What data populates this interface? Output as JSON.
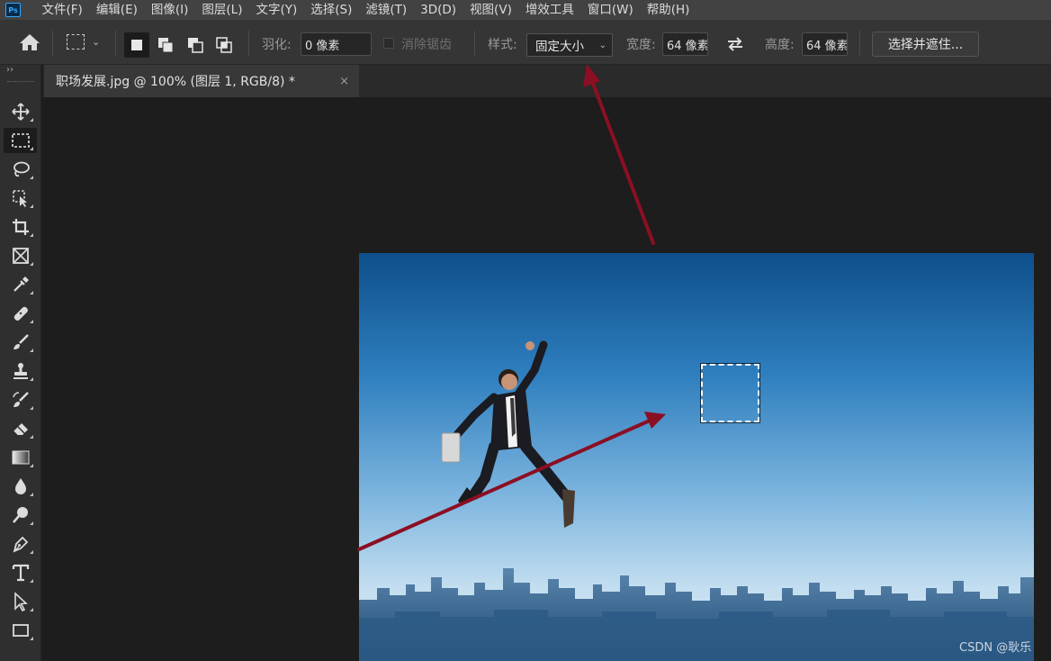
{
  "app": {
    "logo_text": "Ps"
  },
  "menu": [
    "文件(F)",
    "编辑(E)",
    "图像(I)",
    "图层(L)",
    "文字(Y)",
    "选择(S)",
    "滤镜(T)",
    "3D(D)",
    "视图(V)",
    "增效工具",
    "窗口(W)",
    "帮助(H)"
  ],
  "options": {
    "feather_label": "羽化:",
    "feather_value": "0 像素",
    "antialias_label": "消除锯齿",
    "style_label": "样式:",
    "style_value": "固定大小",
    "width_label": "宽度:",
    "width_value": "64 像素",
    "height_label": "高度:",
    "height_value": "64 像素",
    "select_mask_label": "选择并遮住..."
  },
  "document": {
    "tab_title": "职场发展.jpg @ 100% (图层 1, RGB/8) *",
    "close_glyph": "×"
  },
  "toolbox": {
    "collapse_glyph": "››",
    "tools": [
      {
        "name": "move-tool",
        "icon": "move-icon",
        "active": false
      },
      {
        "name": "rectangular-marquee-tool",
        "icon": "marquee-icon",
        "active": true
      },
      {
        "name": "lasso-tool",
        "icon": "lasso-icon",
        "active": false
      },
      {
        "name": "object-selection-tool",
        "icon": "object-select-icon",
        "active": false
      },
      {
        "name": "crop-tool",
        "icon": "crop-icon",
        "active": false
      },
      {
        "name": "frame-tool",
        "icon": "frame-icon",
        "active": false
      },
      {
        "name": "eyedropper-tool",
        "icon": "eyedropper-icon",
        "active": false
      },
      {
        "name": "healing-brush-tool",
        "icon": "bandage-icon",
        "active": false
      },
      {
        "name": "brush-tool",
        "icon": "brush-icon",
        "active": false
      },
      {
        "name": "clone-stamp-tool",
        "icon": "stamp-icon",
        "active": false
      },
      {
        "name": "history-brush-tool",
        "icon": "history-brush-icon",
        "active": false
      },
      {
        "name": "eraser-tool",
        "icon": "eraser-icon",
        "active": false
      },
      {
        "name": "gradient-tool",
        "icon": "gradient-icon",
        "active": false
      },
      {
        "name": "blur-tool",
        "icon": "drop-icon",
        "active": false
      },
      {
        "name": "dodge-tool",
        "icon": "dodge-icon",
        "active": false
      },
      {
        "name": "pen-tool",
        "icon": "pen-icon",
        "active": false
      },
      {
        "name": "type-tool",
        "icon": "type-icon",
        "active": false
      },
      {
        "name": "path-selection-tool",
        "icon": "arrow-cursor-icon",
        "active": false
      },
      {
        "name": "rectangle-tool",
        "icon": "rectangle-icon",
        "active": false
      }
    ]
  },
  "watermark": "CSDN @耿乐",
  "colors": {
    "annotation_arrow": "#8b0f23",
    "sky_top": "#0f5a95",
    "sky_bottom": "#cfe3f1",
    "ps_blue": "#31a8ff"
  }
}
